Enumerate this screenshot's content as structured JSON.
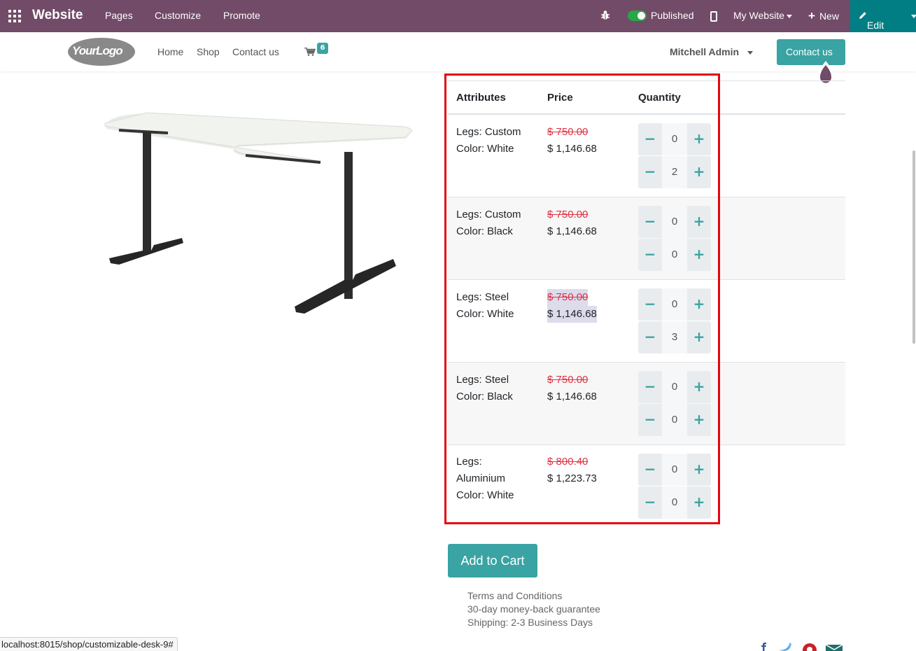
{
  "adminbar": {
    "brand": "Website",
    "menu": [
      "Pages",
      "Customize",
      "Promote"
    ],
    "published_label": "Published",
    "site_selector": "My Website",
    "new_label": "New",
    "edit_label": "Edit",
    "bg_color": "#714b67",
    "edit_bg_color": "#017e84"
  },
  "sitenav": {
    "logo_text": "YourLogo",
    "links": [
      "Home",
      "Shop",
      "Contact us"
    ],
    "cart_count": "6",
    "user": "Mitchell Admin",
    "contact_button": "Contact us"
  },
  "table": {
    "headers": [
      "Attributes",
      "Price",
      "Quantity"
    ],
    "rows": [
      {
        "attr": [
          "Legs: Custom",
          "Color: White"
        ],
        "old_price": "$ 750.00",
        "price": "$ 1,146.68",
        "qty": [
          "0",
          "2"
        ]
      },
      {
        "attr": [
          "Legs: Custom",
          "Color: Black"
        ],
        "old_price": "$ 750.00",
        "price": "$ 1,146.68",
        "qty": [
          "0",
          "0"
        ]
      },
      {
        "attr": [
          "Legs: Steel",
          "Color: White"
        ],
        "old_price": "$ 750.00",
        "price": "$ 1,146.68",
        "qty": [
          "0",
          "3"
        ]
      },
      {
        "attr": [
          "Legs: Steel",
          "Color: Black"
        ],
        "old_price": "$ 750.00",
        "price": "$ 1,146.68",
        "qty": [
          "0",
          "0"
        ]
      },
      {
        "attr": [
          "Legs:",
          "Aluminium",
          "Color: White"
        ],
        "old_price": "$ 800.40",
        "price": "$ 1,223.73",
        "qty": [
          "0",
          "0"
        ]
      }
    ],
    "minus_symbol": "−",
    "plus_symbol": "+"
  },
  "add_to_cart": "Add to Cart",
  "info_lines": [
    "Terms and Conditions",
    "30-day money-back guarantee",
    "Shipping: 2-3 Business Days"
  ],
  "status_url": "localhost:8015/shop/customizable-desk-9#",
  "colors": {
    "accent": "#3aa3a3",
    "strike_price": "#dc3545",
    "annotation_box": "#e4050f"
  }
}
